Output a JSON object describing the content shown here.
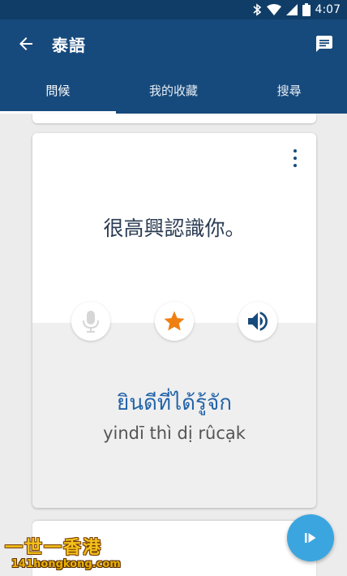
{
  "status_bar": {
    "time": "4:07",
    "icons": [
      "bluetooth-icon",
      "wifi-icon",
      "signal-icon",
      "battery-icon"
    ]
  },
  "app_bar": {
    "title": "泰語",
    "back_icon": "arrow-left-icon",
    "message_icon": "message-icon"
  },
  "tabs": [
    {
      "label": "問候",
      "active": true
    },
    {
      "label": "我的收藏",
      "active": false
    },
    {
      "label": "搜尋",
      "active": false
    }
  ],
  "card": {
    "phrase": "很高興認識你。",
    "thai": "ยินดีที่ได้รู้จัก",
    "romanization": "yindī thì dị rûcạk",
    "actions": [
      "microphone-icon",
      "star-icon",
      "speaker-icon"
    ],
    "menu_icon": "more-vertical-icon"
  },
  "fab": {
    "icon": "play-next-icon"
  },
  "watermark": {
    "line1": "一世一香港",
    "line2": "141hongkong.com"
  },
  "colors": {
    "primary": "#174a7c",
    "status_bar": "#0f3d67",
    "accent": "#3ba5e0",
    "star": "#f07f12",
    "thai_text": "#2364a8"
  }
}
